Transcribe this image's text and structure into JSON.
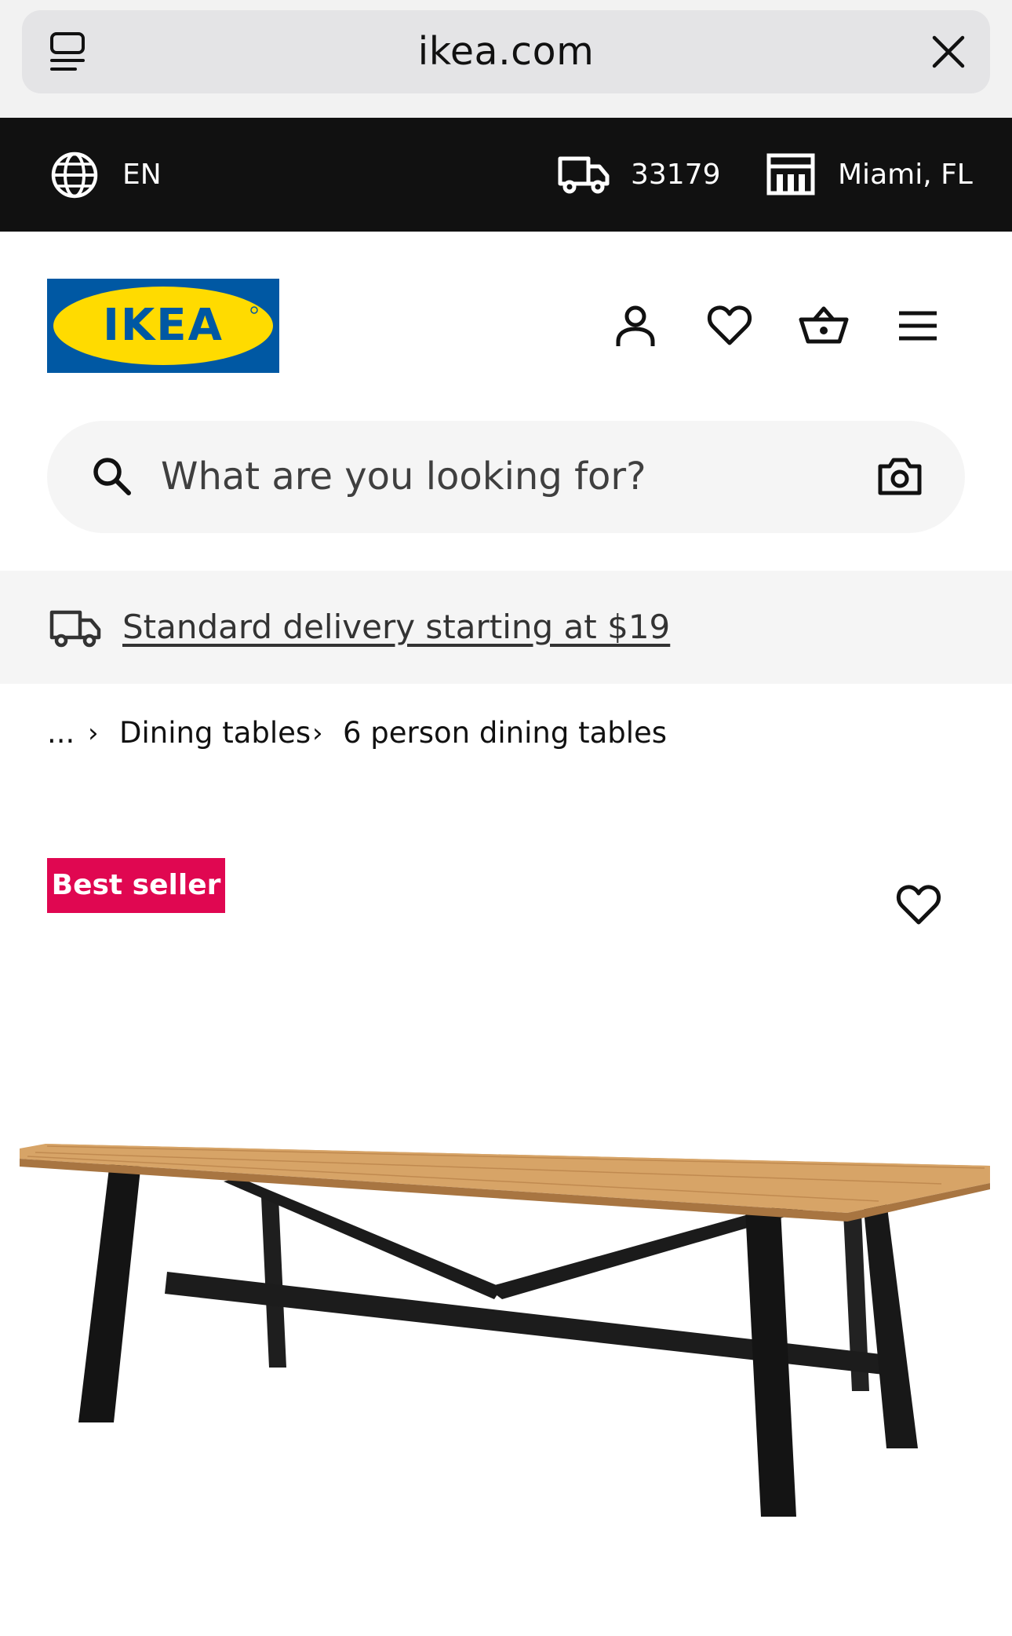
{
  "browser": {
    "url": "ikea.com"
  },
  "topbar": {
    "language": "EN",
    "zip": "33179",
    "store": "Miami, FL"
  },
  "header": {
    "logo_text": "IKEA",
    "icons": [
      "account-icon",
      "heart-icon",
      "basket-icon",
      "menu-icon"
    ]
  },
  "search": {
    "placeholder": "What are you looking for?"
  },
  "delivery": {
    "text": "Standard delivery starting at $19"
  },
  "breadcrumb": {
    "ellipsis": "...",
    "items": [
      "Dining tables",
      "6 person dining tables"
    ]
  },
  "product": {
    "badge": "Best seller"
  },
  "colors": {
    "ikea_blue": "#0058a3",
    "ikea_yellow": "#ffdb00",
    "badge": "#e00751",
    "topbar": "#111111"
  }
}
